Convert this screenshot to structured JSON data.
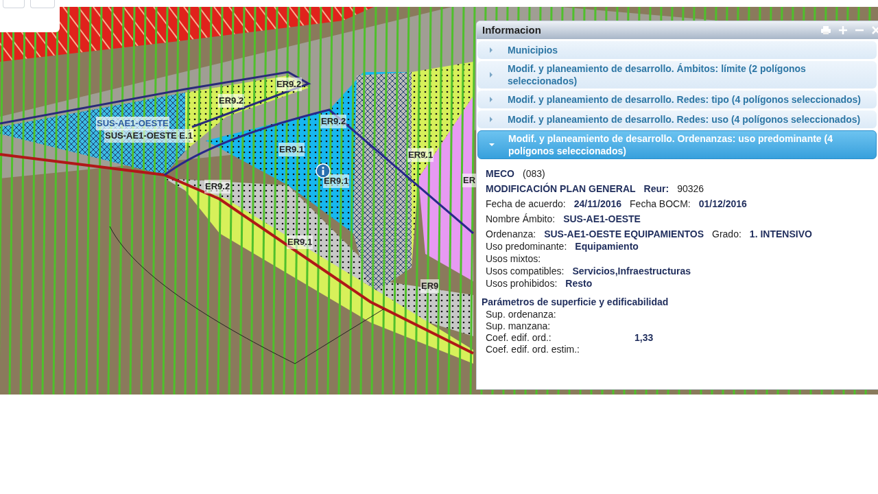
{
  "map": {
    "labels": [
      {
        "text": "ER9.2",
        "kind": "zone"
      },
      {
        "text": "ER9.2",
        "kind": "zone"
      },
      {
        "text": "SUS-AE1-OESTE",
        "kind": "area"
      },
      {
        "text": "SUS-AE1-OESTE E.1",
        "kind": "zone"
      },
      {
        "text": "ER9.2",
        "kind": "zone"
      },
      {
        "text": "ER9.1",
        "kind": "zone"
      },
      {
        "text": "ER9.1",
        "kind": "zone"
      },
      {
        "text": "ER",
        "kind": "zone"
      },
      {
        "text": "ER9.1",
        "kind": "zone"
      },
      {
        "text": "ER9.2",
        "kind": "zone"
      },
      {
        "text": "ER9.1",
        "kind": "zone"
      },
      {
        "text": "ER9",
        "kind": "zone"
      }
    ]
  },
  "panel": {
    "title": "Informacion",
    "sections": [
      {
        "title": "Municipios",
        "expanded": false
      },
      {
        "title": "Modif. y planeamiento de desarrollo. Ámbitos: límite (2 polígonos seleccionados)",
        "expanded": false
      },
      {
        "title": "Modif. y planeamiento de desarrollo. Redes: tipo (4 polígonos seleccionados)",
        "expanded": false
      },
      {
        "title": "Modif. y planeamiento de desarrollo. Redes: uso (4 polígonos seleccionados)",
        "expanded": false
      },
      {
        "title": "Modif. y planeamiento de desarrollo. Ordenanzas: uso predominante (4 polígonos seleccionados)",
        "expanded": true
      }
    ],
    "detail": {
      "groups": [
        {
          "rows": [
            [
              {
                "text": "MECO",
                "bold": true
              },
              {
                "text": "(083)",
                "bold": false
              }
            ]
          ]
        },
        {
          "rows": [
            [
              {
                "text": "MODIFICACIÓN PLAN GENERAL",
                "bold": true
              },
              {
                "text": "Reur:",
                "bold": true
              },
              {
                "text": "90326",
                "bold": false
              }
            ]
          ]
        },
        {
          "rows": [
            [
              {
                "text": "Fecha de acuerdo:",
                "bold": false
              },
              {
                "text": "24/11/2016",
                "bold": true
              },
              {
                "text": "Fecha BOCM:",
                "bold": false
              },
              {
                "text": "01/12/2016",
                "bold": true
              }
            ]
          ]
        },
        {
          "rows": [
            [
              {
                "text": "Nombre Ámbito:",
                "bold": false
              },
              {
                "text": "SUS-AE1-OESTE",
                "bold": true
              }
            ]
          ]
        },
        {
          "rows": [
            [
              {
                "text": "Ordenanza:",
                "bold": false
              },
              {
                "text": "SUS-AE1-OESTE EQUIPAMIENTOS",
                "bold": true
              },
              {
                "text": "Grado:",
                "bold": false
              },
              {
                "text": "1. INTENSIVO",
                "bold": true
              }
            ],
            [
              {
                "text": "Uso predominante:",
                "bold": false
              },
              {
                "text": "Equipamiento",
                "bold": true
              }
            ],
            [
              {
                "text": "Usos mixtos:",
                "bold": false
              }
            ],
            [
              {
                "text": "Usos compatibles:",
                "bold": false
              },
              {
                "text": "Servicios,Infraestructuras",
                "bold": true
              }
            ],
            [
              {
                "text": "Usos prohibidos:",
                "bold": false
              },
              {
                "text": "Resto",
                "bold": true
              }
            ]
          ]
        }
      ],
      "params_title": "Parámetros de superficie y edificabilidad",
      "params": [
        {
          "label": "Sup. ordenanza:"
        },
        {
          "label": "Sup. manzana:"
        },
        {
          "label": "Coef. edif. ord.:",
          "value": "1,33"
        },
        {
          "label": "Coef. edif. ord. estim.:"
        }
      ]
    }
  }
}
